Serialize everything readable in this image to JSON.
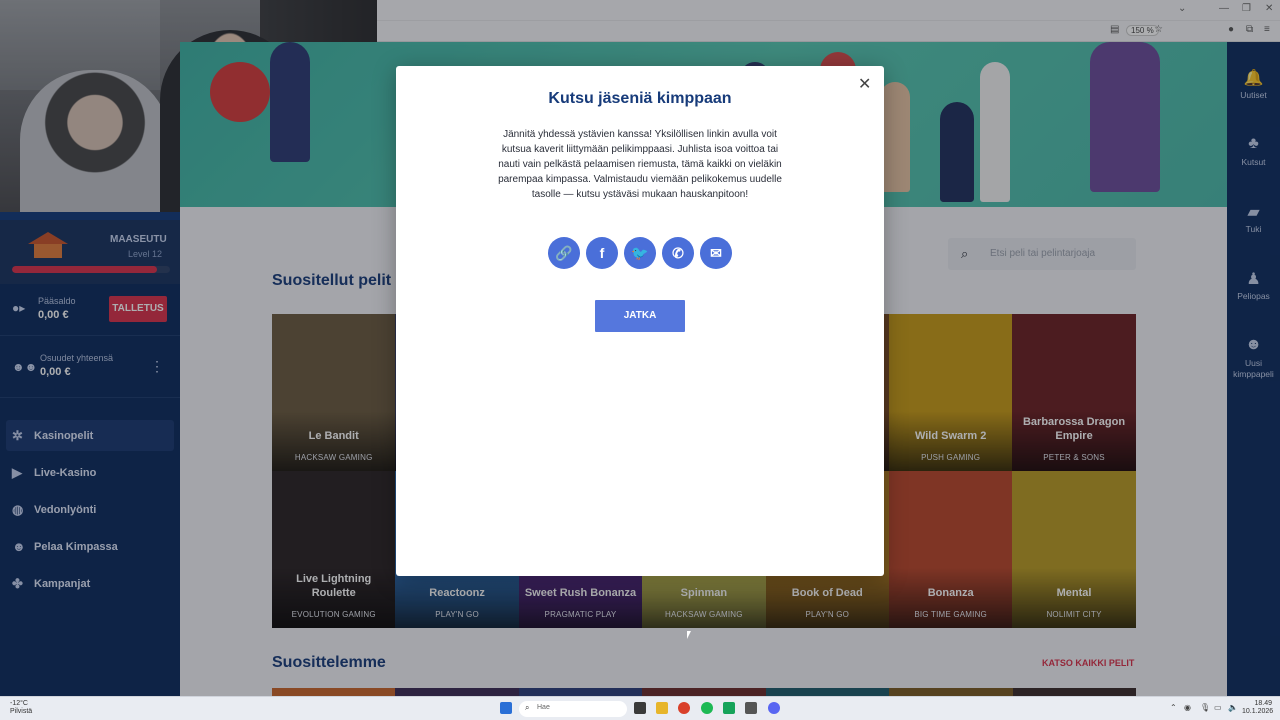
{
  "browser": {
    "zoom": "150 %"
  },
  "sidebar": {
    "level_name": "MAASEUTU",
    "level": "Level 12",
    "level_progress": 0.92,
    "balance_label": "Pääsaldo",
    "balance_value": "0,00 €",
    "deposit_label": "TALLETUS",
    "shares_label": "Osuudet yhteensä",
    "shares_value": "0,00 €",
    "nav": [
      {
        "label": "Kasinopelit",
        "icon": "roulette-icon",
        "active": true
      },
      {
        "label": "Live-Kasino",
        "icon": "play-icon",
        "active": false
      },
      {
        "label": "Vedonlyönti",
        "icon": "ball-icon",
        "active": false
      },
      {
        "label": "Pelaa Kimpassa",
        "icon": "group-icon",
        "active": false
      },
      {
        "label": "Kampanjat",
        "icon": "gift-icon",
        "active": false
      }
    ]
  },
  "right_sidebar": [
    {
      "label": "Uutiset",
      "icon": "bell-icon"
    },
    {
      "label": "Kutsut",
      "icon": "invite-icon"
    },
    {
      "label": "Tuki",
      "icon": "chat-icon"
    },
    {
      "label": "Peliopas",
      "icon": "guide-icon"
    },
    {
      "label": "Uusi kimppapeli",
      "icon": "new-group-icon"
    }
  ],
  "main": {
    "search_placeholder": "Etsi peli tai pelintarjoaja",
    "section1_title": "Suositellut pelit",
    "section2_title": "Suosittelemme",
    "see_all": "KATSO KAIKKI PELIT",
    "games": [
      {
        "name": "Le Bandit",
        "provider": "HACKSAW GAMING",
        "color": "#6b5a3f"
      },
      {
        "name": "",
        "provider": "",
        "color": "#3a3f68"
      },
      {
        "name": "",
        "provider": "",
        "color": "#6b2f68"
      },
      {
        "name": "",
        "provider": "",
        "color": "#3a6b48"
      },
      {
        "name": "",
        "provider": "",
        "color": "#7a4a22"
      },
      {
        "name": "Wild Swarm 2",
        "provider": "PUSH GAMING",
        "color": "#c79a16"
      },
      {
        "name": "Barbarossa Dragon Empire",
        "provider": "PETER & SONS",
        "color": "#6a1f22"
      },
      {
        "name": "Live Lightning Roulette",
        "provider": "EVOLUTION GAMING",
        "color": "#2a2224"
      },
      {
        "name": "Reactoonz",
        "provider": "PLAY'N GO",
        "color": "#2d6fb8"
      },
      {
        "name": "Sweet Rush Bonanza",
        "provider": "PRAGMATIC PLAY",
        "color": "#5a2a8f"
      },
      {
        "name": "Spinman",
        "provider": "HACKSAW GAMING",
        "color": "#d9d25a"
      },
      {
        "name": "Book of Dead",
        "provider": "PLAY'N GO",
        "color": "#b07a1e"
      },
      {
        "name": "Bonanza",
        "provider": "BIG TIME GAMING",
        "color": "#b8452a"
      },
      {
        "name": "Mental",
        "provider": "NOLIMIT CITY",
        "color": "#b89a24"
      }
    ]
  },
  "modal": {
    "title": "Kutsu jäseniä kimppaan",
    "body": "Jännitä yhdessä ystävien kanssa! Yksilöllisen linkin avulla voit kutsua kaverit liittymään pelikimppaasi. Juhlista isoa voittoa tai nauti vain pelkästä pelaamisen riemusta, tämä kaikki on vieläkin parempaa kimpassa. Valmistaudu viemään pelikokemus uudelle tasolle — kutsu ystäväsi mukaan hauskanpitoon!",
    "share_buttons": [
      {
        "icon": "link-icon",
        "glyph": "🔗"
      },
      {
        "icon": "facebook-icon",
        "glyph": "f"
      },
      {
        "icon": "twitter-icon",
        "glyph": "🐦"
      },
      {
        "icon": "whatsapp-icon",
        "glyph": "✆"
      },
      {
        "icon": "email-icon",
        "glyph": "✉"
      }
    ],
    "continue_label": "JATKA",
    "close_glyph": "✕"
  },
  "taskbar": {
    "weather_temp": "-12°C",
    "weather_text": "Pilvistä",
    "search_placeholder": "Hae",
    "time": "18.49",
    "date": "10.1.2026"
  }
}
